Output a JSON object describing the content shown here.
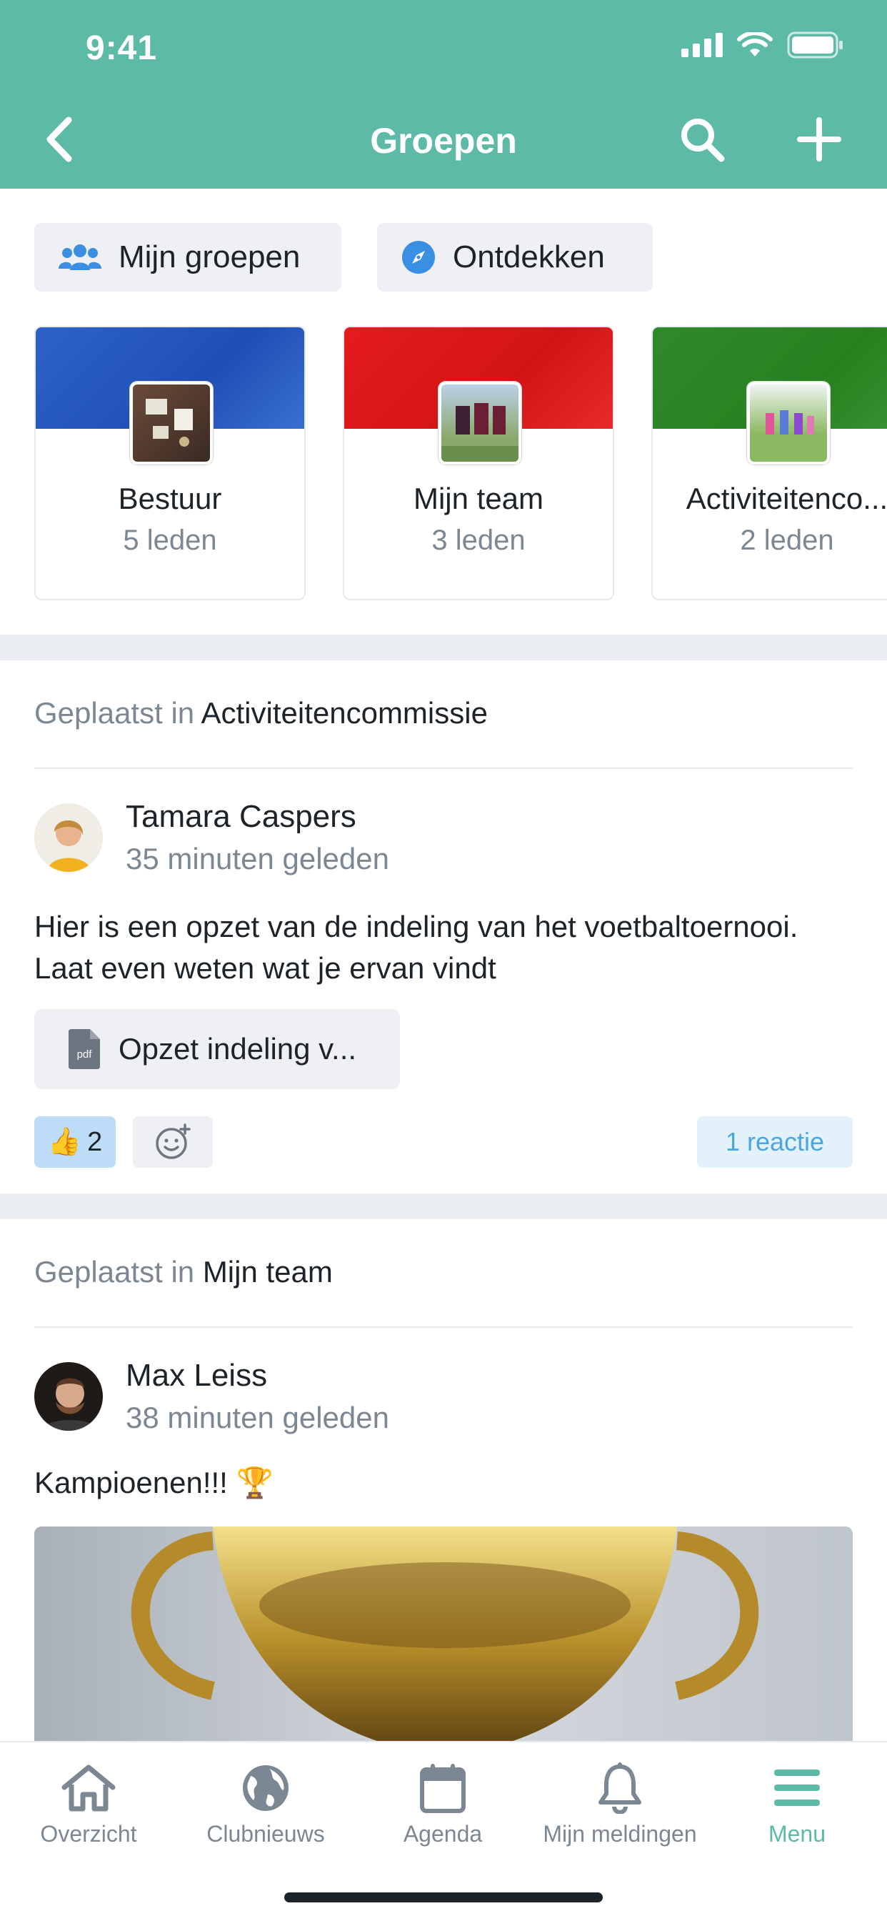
{
  "status_bar": {
    "time": "9:41"
  },
  "nav": {
    "title": "Groepen"
  },
  "segments": {
    "mine": "Mijn groepen",
    "discover": "Ontdekken"
  },
  "groups": [
    {
      "name": "Bestuur",
      "count": "5 leden"
    },
    {
      "name": "Mijn team",
      "count": "3 leden"
    },
    {
      "name": "Activiteitenco...",
      "count": "2 leden"
    }
  ],
  "posts": [
    {
      "posted_prefix": "Geplaatst in",
      "group": "Activiteitencommissie",
      "author": "Tamara Caspers",
      "time": "35 minuten geleden",
      "text": "Hier is een opzet van de indeling van het voetbaltoernooi. Laat even weten wat je ervan vindt",
      "attachment": {
        "type_label": "pdf",
        "name": "Opzet indeling v..."
      },
      "likes": "2",
      "replies": "1 reactie"
    },
    {
      "posted_prefix": "Geplaatst in",
      "group": "Mijn team",
      "author": "Max Leiss",
      "time": "38 minuten geleden",
      "text": "Kampioenen!!! 🏆"
    }
  ],
  "tabbar": {
    "items": [
      {
        "label": "Overzicht",
        "icon": "home-icon"
      },
      {
        "label": "Clubnieuws",
        "icon": "globe-icon"
      },
      {
        "label": "Agenda",
        "icon": "calendar-icon"
      },
      {
        "label": "Mijn meldingen",
        "icon": "bell-icon"
      },
      {
        "label": "Menu",
        "icon": "menu-icon"
      }
    ],
    "active": "Menu"
  },
  "colors": {
    "primary": "#5cbaa7",
    "muted": "#7b8793",
    "link": "#4ba6e0"
  }
}
